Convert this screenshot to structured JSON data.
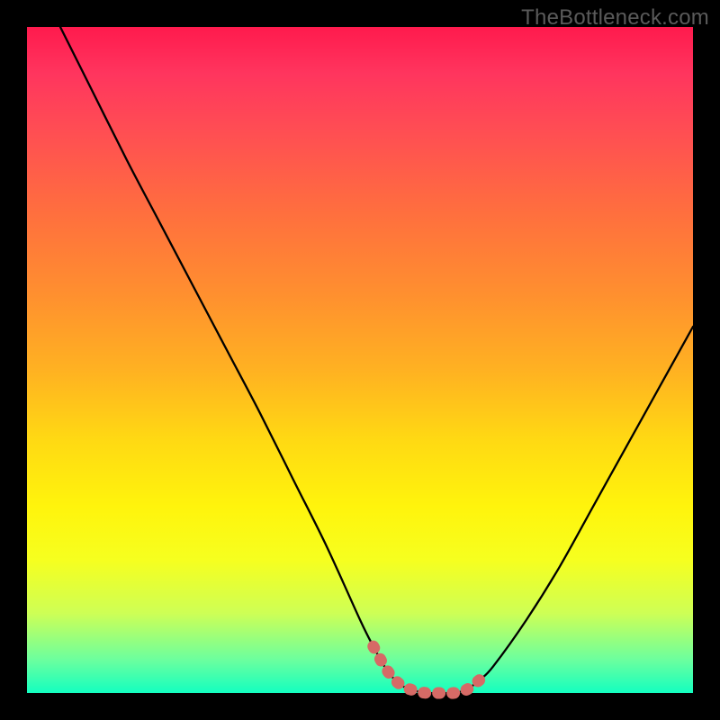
{
  "watermark": "TheBottleneck.com",
  "colors": {
    "frame": "#000000",
    "curve_stroke": "#000000",
    "highlight_stroke": "#d66a66",
    "highlight_fill": "none"
  },
  "chart_data": {
    "type": "line",
    "title": "",
    "xlabel": "",
    "ylabel": "",
    "xlim": [
      0,
      100
    ],
    "ylim": [
      0,
      100
    ],
    "grid": false,
    "legend": false,
    "series": [
      {
        "name": "bottleneck-curve",
        "x": [
          5,
          10,
          15,
          20,
          25,
          30,
          35,
          40,
          45,
          50,
          52,
          54,
          56,
          58,
          60,
          62,
          64,
          66,
          68,
          70,
          75,
          80,
          85,
          90,
          95,
          100
        ],
        "y": [
          100,
          90,
          80,
          70.5,
          61,
          51.5,
          42,
          32,
          22,
          11,
          7,
          3.5,
          1.3,
          0.4,
          0,
          0,
          0,
          0.5,
          2,
          4,
          11,
          19,
          28,
          37,
          46,
          55
        ]
      }
    ],
    "highlight_region": {
      "name": "valley-highlight",
      "x": [
        52,
        54,
        56,
        58,
        60,
        62,
        64,
        66,
        68
      ],
      "y": [
        7,
        3.5,
        1.3,
        0.4,
        0,
        0,
        0,
        0.5,
        2
      ]
    },
    "background_gradient": {
      "top": "#ff1a4d",
      "mid": "#ffd913",
      "bottom": "#13ffc0"
    }
  }
}
